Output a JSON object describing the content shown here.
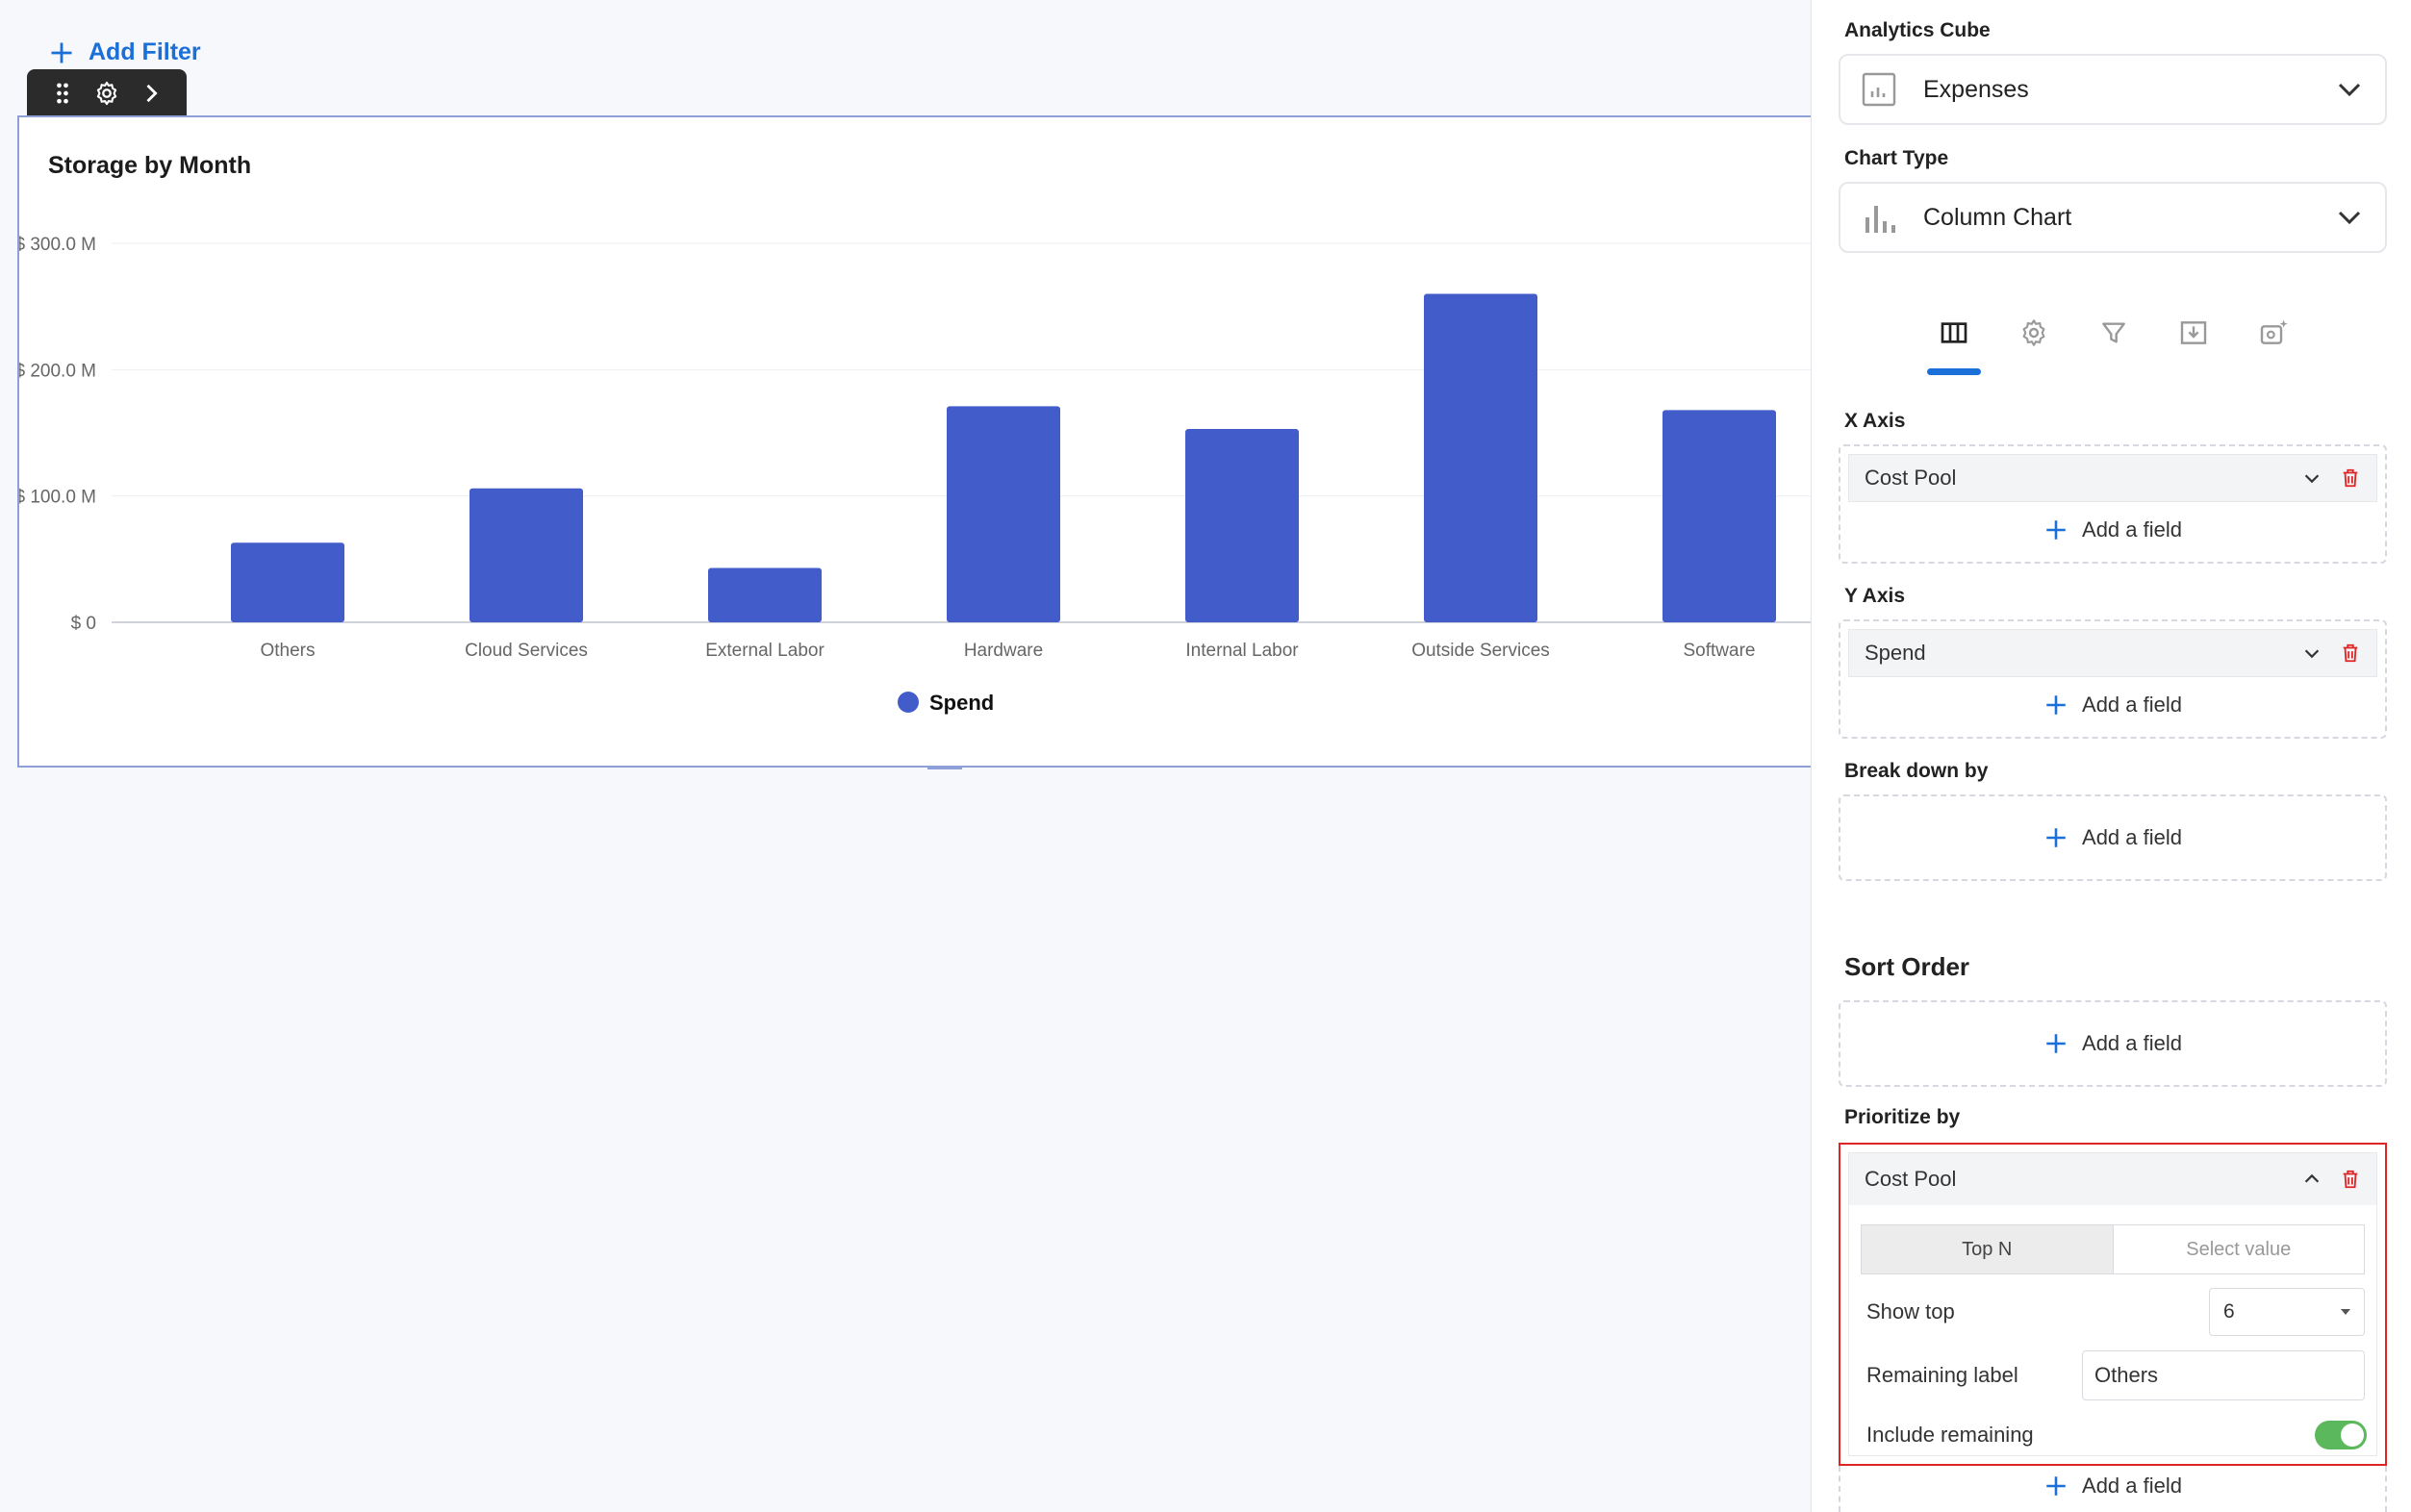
{
  "canvas": {
    "add_filter_label": "Add Filter",
    "toolbar_icons": [
      "drag-handle-icon",
      "gear-icon",
      "chevron-right-icon"
    ]
  },
  "chart": {
    "title": "Storage by Month"
  },
  "chart_data": {
    "type": "bar",
    "categories": [
      "Others",
      "Cloud Services",
      "External Labor",
      "Hardware",
      "Internal Labor",
      "Outside Services",
      "Software"
    ],
    "series": [
      {
        "name": "Spend",
        "values": [
          63,
          106,
          43,
          171,
          153,
          260,
          168
        ]
      }
    ],
    "ylim": [
      0,
      300
    ],
    "yticks": [
      0,
      100,
      200,
      300
    ],
    "ytick_labels": [
      "$ 0",
      "$ 100.0 M",
      "$ 200.0 M",
      "$ 300.0 M"
    ],
    "grid": true,
    "legend": "bottom-center",
    "bar_color": "#425cca"
  },
  "panel": {
    "analytics_cube": {
      "label": "Analytics Cube",
      "value": "Expenses"
    },
    "chart_type": {
      "label": "Chart Type",
      "value": "Column Chart"
    },
    "tabs": [
      "columns-icon",
      "gear-icon",
      "filter-icon",
      "download-icon",
      "image-sparkle-icon"
    ],
    "x_axis": {
      "label": "X Axis",
      "field": "Cost Pool",
      "add_label": "Add a field"
    },
    "y_axis": {
      "label": "Y Axis",
      "field": "Spend",
      "add_label": "Add a field"
    },
    "break_down": {
      "label": "Break down by",
      "add_label": "Add a field"
    },
    "sort_order": {
      "label": "Sort Order",
      "add_label": "Add a field"
    },
    "prioritize": {
      "label": "Prioritize by",
      "field": "Cost Pool",
      "seg_top_n": "Top N",
      "seg_select_value": "Select value",
      "show_top_label": "Show top",
      "show_top_value": "6",
      "remaining_label_label": "Remaining label",
      "remaining_label_value": "Others",
      "include_remaining_label": "Include remaining",
      "include_remaining": true,
      "add_label": "Add a field"
    }
  },
  "colors": {
    "accent": "#1a6fd8",
    "bar": "#425cca",
    "danger": "#e02424",
    "toggle_on": "#5cb85c"
  }
}
